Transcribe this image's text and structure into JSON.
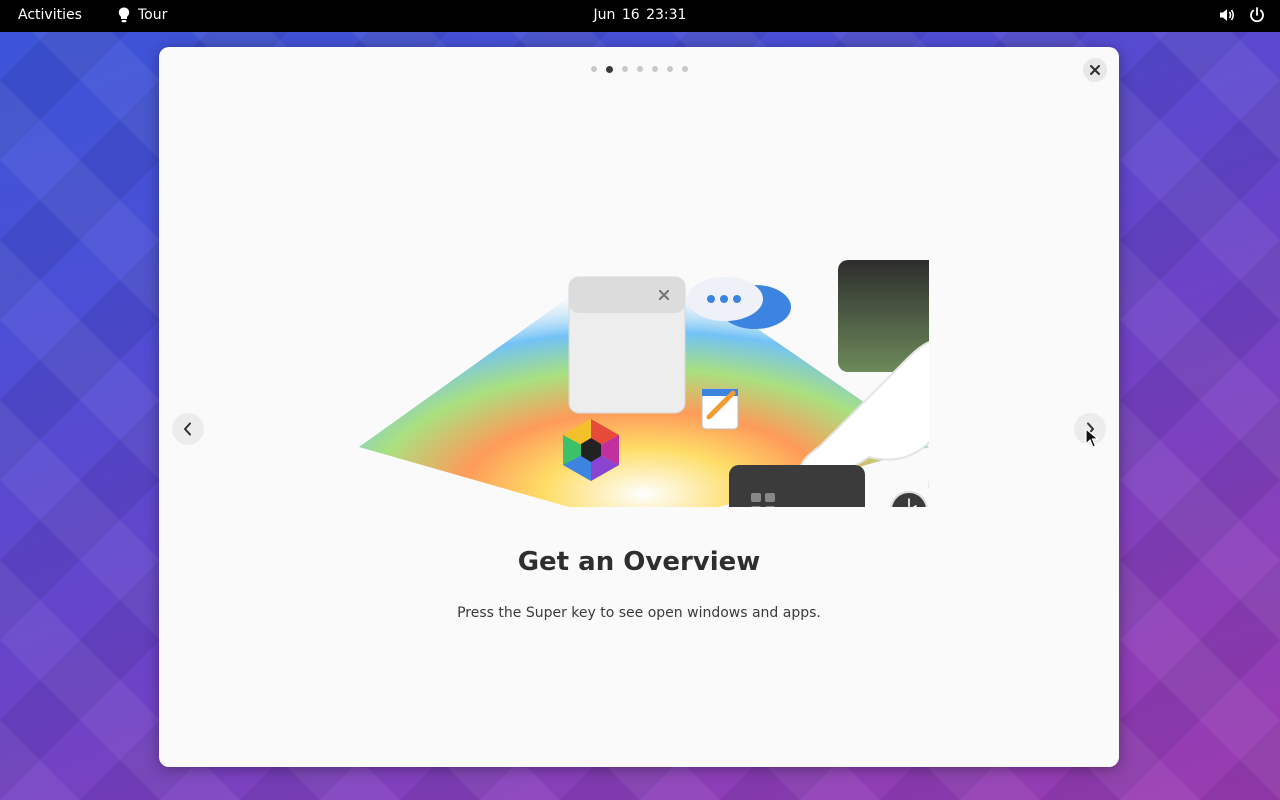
{
  "topbar": {
    "activities": "Activities",
    "app_name": "Tour",
    "app_icon": "lightbulb-icon",
    "clock": "Jun 16  23:31",
    "status_icons": [
      "volume-icon",
      "power-icon"
    ]
  },
  "dialog": {
    "page_count": 7,
    "current_page": 2,
    "title": "Get an Overview",
    "subtitle": "Press the Super key to see open windows and apps.",
    "close_icon": "close-icon",
    "prev_icon": "chevron-left-icon",
    "next_icon": "chevron-right-icon"
  },
  "colors": {
    "topbar_bg": "#000000",
    "dialog_bg": "#fafafa",
    "title": "#2e2e2e"
  }
}
